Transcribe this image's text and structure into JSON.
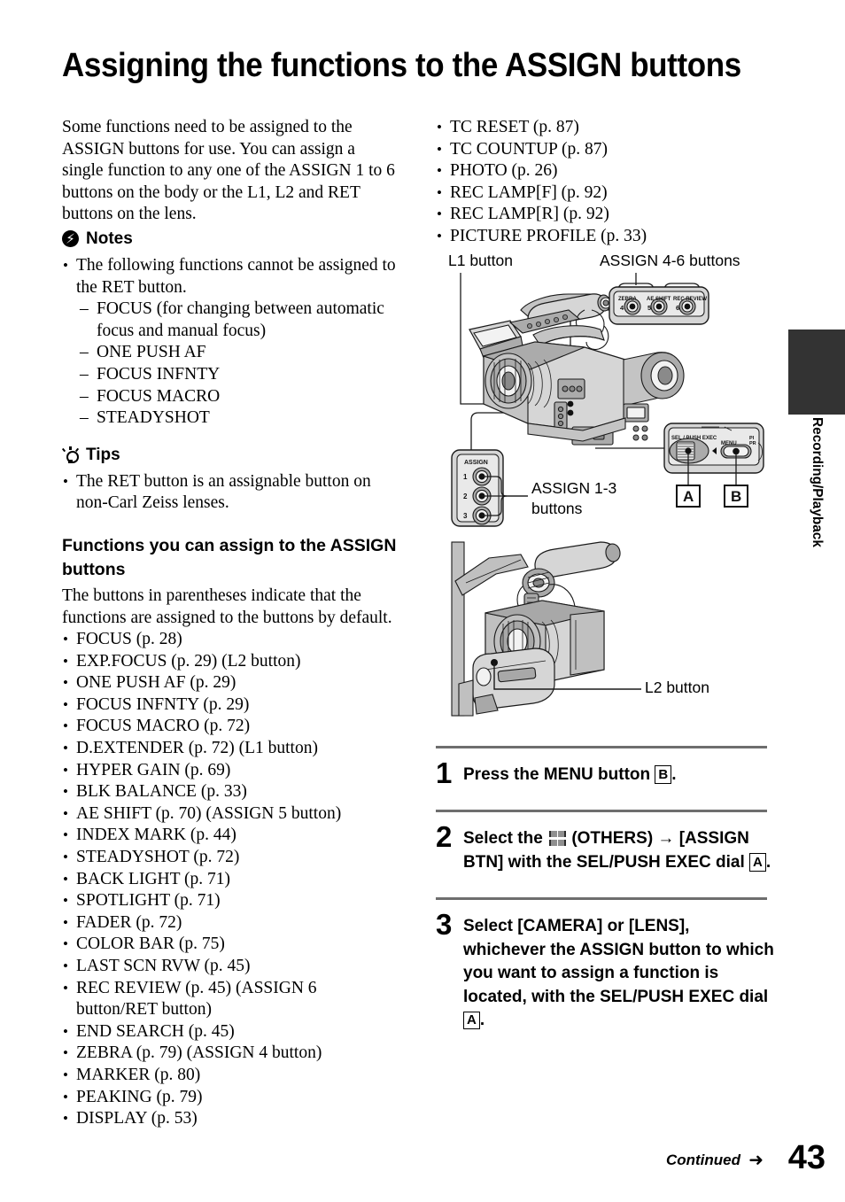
{
  "page": {
    "title": "Assigning the functions to the ASSIGN buttons",
    "number": "43",
    "continued_label": "Continued",
    "continued_arrow": "➜",
    "side_tab_label": "Recording/Playback"
  },
  "left": {
    "intro": "Some functions need to be assigned to the ASSIGN buttons for use. You can assign a single function to any one of the ASSIGN 1 to 6 buttons on the body or the L1, L2 and RET buttons on the lens.",
    "notes_heading": "Notes",
    "notes_icon": "lightning-circle-icon",
    "notes_items": [
      "The following functions cannot be assigned to the RET button."
    ],
    "notes_subitems": [
      "FOCUS (for changing between automatic focus and manual focus)",
      "ONE PUSH AF",
      "FOCUS INFNTY",
      "FOCUS MACRO",
      "STEADYSHOT"
    ],
    "tips_heading": "Tips",
    "tips_icon": "lightbulb-icon",
    "tips_items": [
      "The RET button is an assignable button on non-Carl Zeiss lenses."
    ],
    "functions_heading": "Functions you can assign to the ASSIGN buttons",
    "functions_intro": "The buttons in parentheses indicate that the functions are assigned to the buttons by default.",
    "functions_list": [
      "FOCUS (p. 28)",
      "EXP.FOCUS (p. 29) (L2 button)",
      "ONE PUSH AF (p. 29)",
      "FOCUS INFNTY (p. 29)",
      "FOCUS MACRO (p. 72)",
      "D.EXTENDER (p. 72) (L1 button)",
      "HYPER GAIN (p. 69)",
      "BLK BALANCE (p. 33)",
      "AE SHIFT (p. 70) (ASSIGN 5 button)",
      "INDEX MARK (p. 44)",
      "STEADYSHOT (p. 72)",
      "BACK LIGHT (p. 71)",
      "SPOTLIGHT (p. 71)",
      "FADER (p. 72)",
      "COLOR BAR (p. 75)",
      "LAST SCN RVW (p. 45)",
      "REC REVIEW (p. 45) (ASSIGN 6 button/RET button)",
      "END SEARCH (p. 45)",
      "ZEBRA (p. 79) (ASSIGN 4 button)",
      "MARKER (p. 80)",
      "PEAKING (p. 79)",
      "DISPLAY (p. 53)"
    ]
  },
  "right": {
    "functions_list_cont": [
      "TC RESET (p. 87)",
      "TC COUNTUP (p. 87)",
      "PHOTO (p. 26)",
      "REC LAMP[F] (p. 92)",
      "REC LAMP[R] (p. 92)",
      "PICTURE PROFILE (p. 33)"
    ],
    "figure1": {
      "label_l1": "L1 button",
      "label_assign46": "ASSIGN 4-6 buttons",
      "label_assign13_line1": "ASSIGN 1-3",
      "label_assign13_line2": "buttons",
      "callout_assign46": {
        "buttons": [
          {
            "num": "4",
            "label": "ZEBRA"
          },
          {
            "num": "5",
            "label": "AE SHIFT"
          },
          {
            "num": "6",
            "label": "REC REVIEW"
          }
        ]
      },
      "callout_assign13": {
        "header": "ASSIGN",
        "buttons": [
          {
            "num": "1"
          },
          {
            "num": "2"
          },
          {
            "num": "3"
          }
        ]
      },
      "callout_dial": {
        "dial_label": "SEL / PUSH EXEC",
        "menu_label": "MENU",
        "pp_label_line1": "PI",
        "pp_label_line2": "PR"
      },
      "key_a": "A",
      "key_b": "B"
    },
    "figure2": {
      "label_l2": "L2 button"
    },
    "steps": [
      {
        "num": "1",
        "parts": [
          {
            "t": "text",
            "v": "Press the MENU button "
          },
          {
            "t": "key",
            "v": "B"
          },
          {
            "t": "text",
            "v": "."
          }
        ]
      },
      {
        "num": "2",
        "parts": [
          {
            "t": "text",
            "v": "Select the "
          },
          {
            "t": "icon",
            "v": "others-grid-icon"
          },
          {
            "t": "text",
            "v": " (OTHERS) → [ASSIGN BTN] with the SEL/PUSH EXEC dial "
          },
          {
            "t": "key",
            "v": "A"
          },
          {
            "t": "text",
            "v": "."
          }
        ]
      },
      {
        "num": "3",
        "parts": [
          {
            "t": "text",
            "v": "Select [CAMERA] or [LENS], whichever the ASSIGN button to which you want to assign a function is located, with the SEL/PUSH EXEC dial "
          },
          {
            "t": "key",
            "v": "A"
          },
          {
            "t": "text",
            "v": "."
          }
        ]
      }
    ]
  },
  "colors": {
    "rule": "#6e6e6e",
    "tab": "#333333",
    "illustration_light": "#d8d8d8",
    "illustration_mid": "#b4b4b4",
    "illustration_dark": "#6e6e6e"
  }
}
